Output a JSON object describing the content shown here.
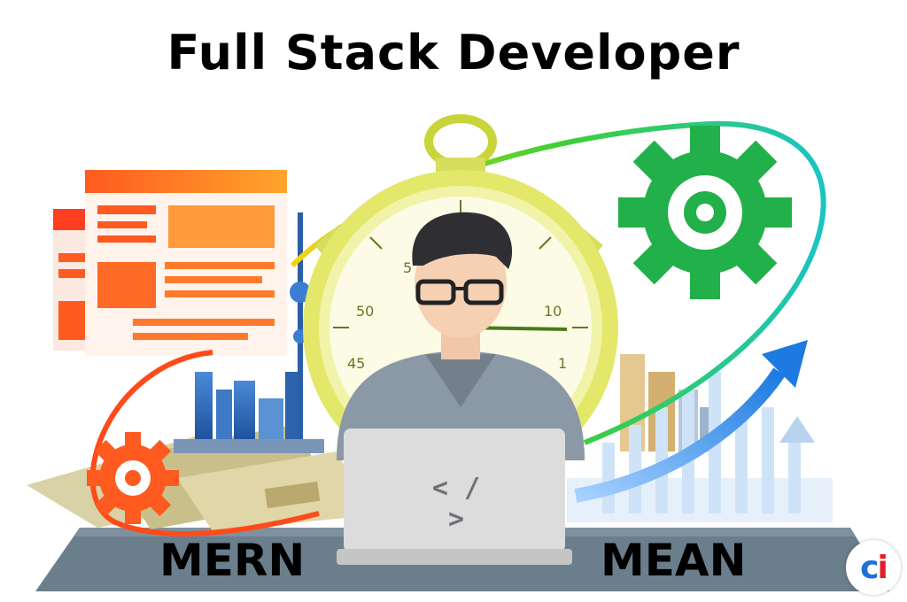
{
  "title": "Full Stack Developer",
  "labels": {
    "left": "MERN",
    "right": "MEAN"
  },
  "laptop": {
    "code_symbol": "< / >"
  },
  "stopwatch": {
    "dial_numbers": [
      "5",
      "50",
      "45",
      "10",
      "1"
    ]
  },
  "logo": {
    "c": "c",
    "i": "i"
  },
  "colors": {
    "orange": "#f26a21",
    "green": "#26b34a",
    "blue": "#2e7ad6",
    "platform": "#6b7e8c"
  },
  "icons": [
    "webpage-icon",
    "gear-icon",
    "stopwatch-icon",
    "arrow-up-icon",
    "laptop-icon",
    "developer-avatar"
  ]
}
